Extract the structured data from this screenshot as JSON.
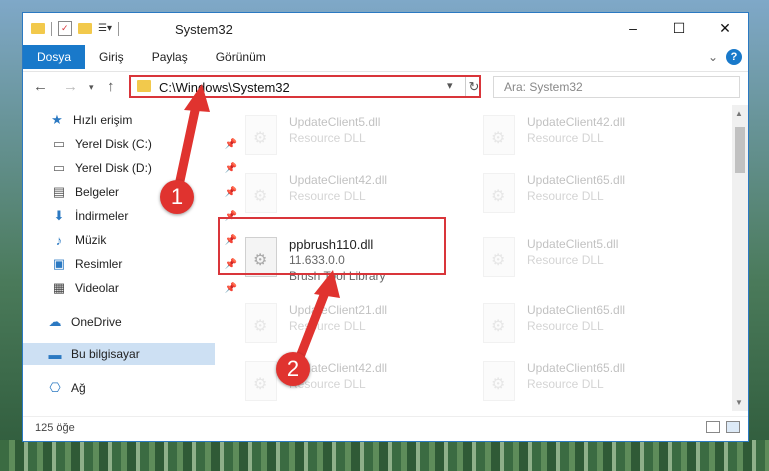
{
  "window": {
    "title": "System32",
    "buttons": {
      "minimize": "–",
      "maximize": "☐",
      "close": "✕"
    }
  },
  "ribbon": {
    "tabs": [
      "Dosya",
      "Giriş",
      "Paylaş",
      "Görünüm"
    ],
    "active_tab": "Dosya",
    "help": "?",
    "expand": "⌄"
  },
  "address": {
    "path": "C:\\Windows\\System32",
    "search_placeholder": "Ara: System32"
  },
  "sidebar": {
    "items": [
      {
        "label": "Hızlı erişim",
        "icon": "star-icon",
        "pinned": false
      },
      {
        "label": "Yerel Disk (C:)",
        "icon": "drive-icon",
        "pinned": true
      },
      {
        "label": "Yerel Disk (D:)",
        "icon": "drive-icon",
        "pinned": true
      },
      {
        "label": "Belgeler",
        "icon": "documents-icon",
        "pinned": true
      },
      {
        "label": "İndirmeler",
        "icon": "download-icon",
        "pinned": true
      },
      {
        "label": "Müzik",
        "icon": "music-icon",
        "pinned": true
      },
      {
        "label": "Resimler",
        "icon": "pictures-icon",
        "pinned": true
      },
      {
        "label": "Videolar",
        "icon": "videos-icon",
        "pinned": true
      },
      {
        "label": "OneDrive",
        "icon": "cloud-icon",
        "pinned": false
      },
      {
        "label": "Bu bilgisayar",
        "icon": "computer-icon",
        "pinned": false
      },
      {
        "label": "Ağ",
        "icon": "network-icon",
        "pinned": false
      }
    ]
  },
  "files": {
    "left": [
      {
        "name": "UpdateClient5.dll",
        "type": "Resource DLL"
      },
      {
        "name": "UpdateClient42.dll",
        "type": "Resource DLL"
      },
      {
        "name": "ppbrush110.dll",
        "version": "11.633.0.0",
        "type": "Brush Tool Library"
      },
      {
        "name": "UpdateClient21.dll",
        "type": "Resource DLL"
      },
      {
        "name": "UpdateClient42.dll",
        "type": "Resource DLL"
      }
    ],
    "right": [
      {
        "name": "UpdateClient42.dll",
        "type": "Resource DLL"
      },
      {
        "name": "UpdateClient65.dll",
        "type": "Resource DLL"
      },
      {
        "name": "UpdateClient5.dll",
        "type": "Resource DLL"
      },
      {
        "name": "UpdateClient65.dll",
        "type": "Resource DLL"
      },
      {
        "name": "UpdateClient65.dll",
        "type": "Resource DLL"
      }
    ]
  },
  "status": {
    "item_count": "125 öğe"
  },
  "annotations": {
    "badge1": "1",
    "badge2": "2",
    "color": "#e0332f"
  }
}
